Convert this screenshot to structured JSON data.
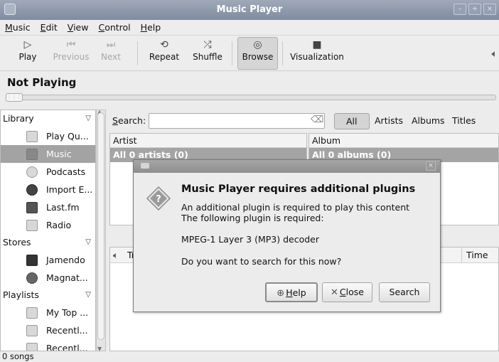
{
  "window": {
    "title": "Music Player"
  },
  "menubar": [
    {
      "label": "Music",
      "mnemonic": "M",
      "rest": "usic"
    },
    {
      "label": "Edit",
      "mnemonic": "E",
      "rest": "dit"
    },
    {
      "label": "View",
      "mnemonic": "V",
      "rest": "iew"
    },
    {
      "label": "Control",
      "mnemonic": "C",
      "rest": "ontrol"
    },
    {
      "label": "Help",
      "mnemonic": "H",
      "rest": "elp"
    }
  ],
  "toolbar": {
    "play": "Play",
    "previous": "Previous",
    "next": "Next",
    "repeat": "Repeat",
    "shuffle": "Shuffle",
    "browse": "Browse",
    "visualization": "Visualization"
  },
  "now_playing": {
    "title": "Not Playing"
  },
  "sidebar": {
    "library_label": "Library",
    "library_items": [
      {
        "label": "Play Qu...",
        "icon": "play-queue-icon"
      },
      {
        "label": "Music",
        "icon": "music-note-icon",
        "selected": true
      },
      {
        "label": "Podcasts",
        "icon": "podcast-icon"
      },
      {
        "label": "Import E...",
        "icon": "import-error-icon"
      },
      {
        "label": "Last.fm",
        "icon": "lastfm-icon"
      },
      {
        "label": "Radio",
        "icon": "radio-icon"
      }
    ],
    "stores_label": "Stores",
    "stores_items": [
      {
        "label": "Jamendo",
        "icon": "jamendo-icon"
      },
      {
        "label": "Magnat...",
        "icon": "magnatune-icon"
      }
    ],
    "playlists_label": "Playlists",
    "playlists_items": [
      {
        "label": "My Top ...",
        "icon": "smart-playlist-icon"
      },
      {
        "label": "Recentl...",
        "icon": "smart-playlist-icon"
      },
      {
        "label": "Recentl...",
        "icon": "smart-playlist-icon"
      }
    ]
  },
  "browser": {
    "search_label_mnemonic": "S",
    "search_label_rest": "earch:",
    "search_value": "",
    "filters": [
      "All",
      "Artists",
      "Albums",
      "Titles"
    ],
    "artist_header": "Artist",
    "artist_row": "All 0 artists (0)",
    "album_header": "Album",
    "album_row": "All 0 albums (0)",
    "track_header_partial": "Tr",
    "time_header": "Time"
  },
  "status": {
    "text": "0 songs"
  },
  "dialog": {
    "heading": "Music Player requires additional plugins",
    "line1": "An additional plugin is required to play this content",
    "line2": "The following plugin is required:",
    "plugin": "MPEG-1 Layer 3 (MP3) decoder",
    "question": "Do you want to search for this now?",
    "help_mnemonic": "H",
    "help_rest": "elp",
    "close_mnemonic": "C",
    "close_rest": "lose",
    "search": "Search"
  }
}
